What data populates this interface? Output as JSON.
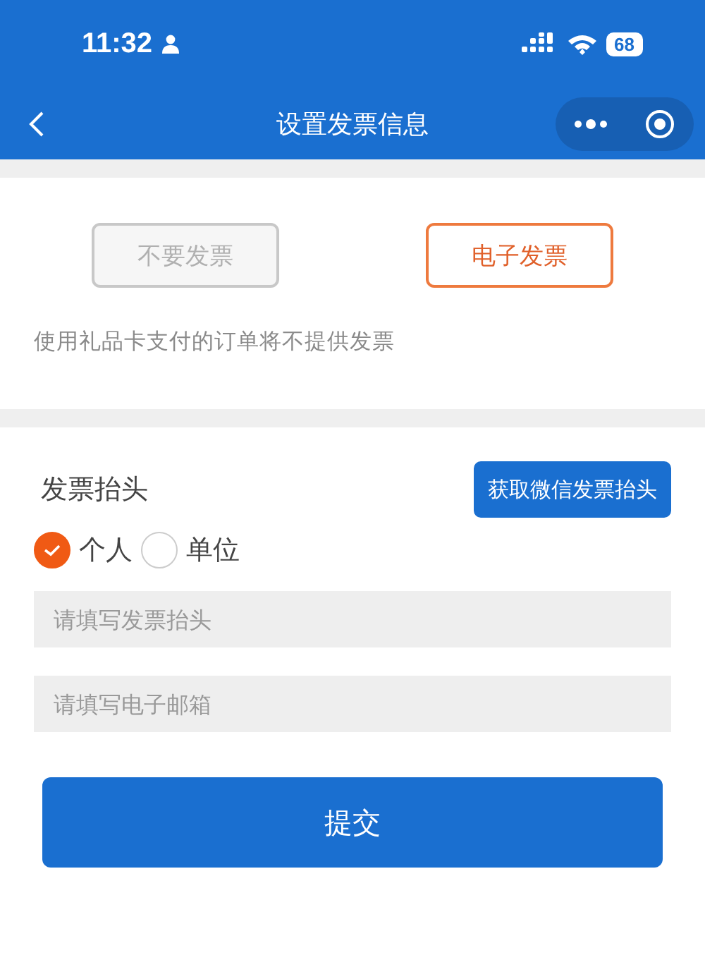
{
  "status_bar": {
    "time": "11:32",
    "battery": "68"
  },
  "nav": {
    "title": "设置发票信息"
  },
  "invoice_types": [
    {
      "label": "不要发票",
      "selected": false
    },
    {
      "label": "电子发票",
      "selected": true
    }
  ],
  "notice": "使用礼品卡支付的订单将不提供发票",
  "header_section": {
    "label": "发票抬头",
    "button": "获取微信发票抬头"
  },
  "title_types": [
    {
      "label": "个人",
      "selected": true
    },
    {
      "label": "单位",
      "selected": false
    }
  ],
  "fields": [
    {
      "placeholder": "请填写发票抬头"
    },
    {
      "placeholder": "请填写电子邮箱"
    }
  ],
  "submit": "提交"
}
